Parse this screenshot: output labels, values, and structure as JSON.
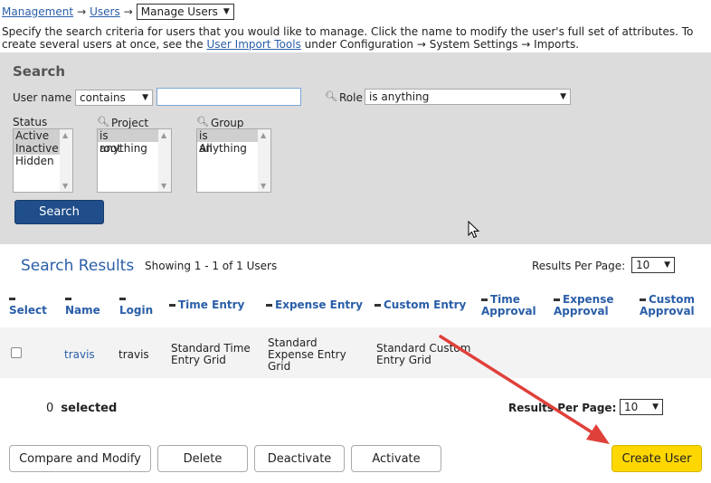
{
  "breadcrumb": {
    "management": "Management",
    "sep1": "→",
    "users": "Users",
    "sep2": "→",
    "current": "Manage Users"
  },
  "intro": {
    "text1": "Specify the search criteria for users that you would like to manage. Click the name to modify the user's full set of attributes. To create several users at once, see the ",
    "link": "User Import Tools",
    "text2": " under Configuration → System Settings → Imports."
  },
  "search": {
    "title": "Search",
    "username_label": "User name",
    "username_op": "contains",
    "username_value": "",
    "role_label": "Role",
    "role_value": "is anything",
    "status_label": "Status",
    "status_options": [
      "Active",
      "Inactive",
      "Hidden"
    ],
    "project_label": "Project",
    "project_options": [
      "is anything",
      "root"
    ],
    "group_label": "Group",
    "group_options": [
      "is anything",
      "All"
    ],
    "button": "Search"
  },
  "results": {
    "title": "Search Results",
    "count": "Showing 1 - 1 of 1 Users",
    "rpp_label": "Results Per Page:",
    "rpp_value": "10",
    "columns": {
      "select": "Select",
      "name": "Name",
      "login": "Login",
      "time_entry": "Time Entry",
      "expense_entry": "Expense Entry",
      "custom_entry": "Custom Entry",
      "time_approval_1": "Time",
      "time_approval_2": "Approval",
      "expense_approval_1": "Expense",
      "expense_approval_2": "Approval",
      "custom_approval_1": "Custom",
      "custom_approval_2": "Approval"
    },
    "rows": [
      {
        "name": "travis",
        "login": "travis",
        "time_entry_1": "Standard Time",
        "time_entry_2": "Entry Grid",
        "expense_entry_1": "Standard",
        "expense_entry_2": "Expense Entry",
        "expense_entry_3": "Grid",
        "custom_entry_1": "Standard Custom",
        "custom_entry_2": "Entry Grid"
      }
    ],
    "selected_count": "0",
    "selected_label": "selected"
  },
  "actions": {
    "compare": "Compare and Modify",
    "delete": "Delete",
    "deactivate": "Deactivate",
    "activate": "Activate",
    "create": "Create User"
  },
  "colors": {
    "accent": "#2a5ea8",
    "search_button": "#1f4e8a",
    "create_button": "#ffd700",
    "annotation_arrow": "#e0403a"
  },
  "icons": [
    "magnifier-icon",
    "caret-down-icon",
    "sort-icon",
    "mouse-cursor-icon",
    "annotation-arrow"
  ]
}
